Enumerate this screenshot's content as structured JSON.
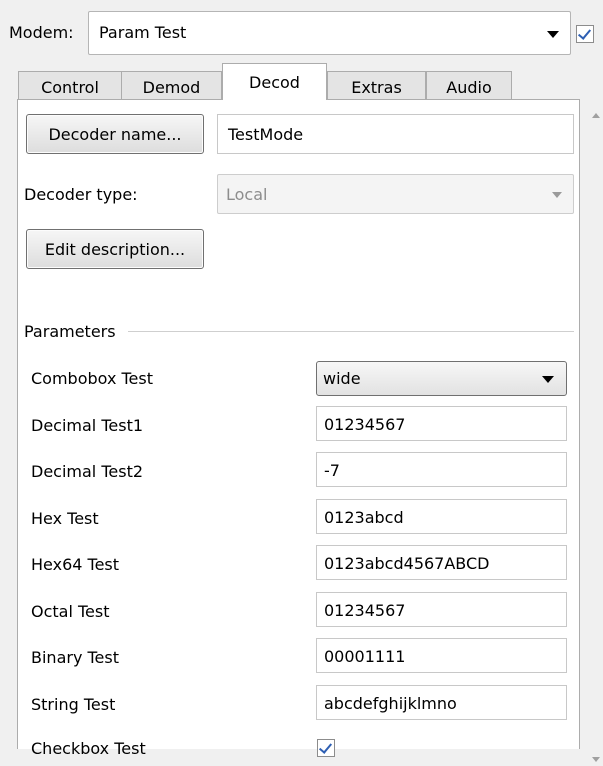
{
  "modem": {
    "label": "Modem:",
    "value": "Param Test",
    "enabled": true
  },
  "tabs": [
    {
      "label": "Control"
    },
    {
      "label": "Demod"
    },
    {
      "label": "Decod",
      "active": true
    },
    {
      "label": "Extras"
    },
    {
      "label": "Audio"
    }
  ],
  "decoder": {
    "name_button": "Decoder name...",
    "name_value": "TestMode",
    "type_label": "Decoder type:",
    "type_value": "Local",
    "edit_button": "Edit description..."
  },
  "parameters": {
    "title": "Parameters",
    "combobox": {
      "label": "Combobox Test",
      "value": "wide"
    },
    "decimal1": {
      "label": "Decimal Test1",
      "value": "01234567"
    },
    "decimal2": {
      "label": "Decimal Test2",
      "value": "-7"
    },
    "hex": {
      "label": "Hex Test",
      "value": "0123abcd"
    },
    "hex64": {
      "label": "Hex64 Test",
      "value": "0123abcd4567ABCD"
    },
    "octal": {
      "label": "Octal Test",
      "value": "01234567"
    },
    "binary": {
      "label": "Binary Test",
      "value": "00001111"
    },
    "string": {
      "label": "String Test",
      "value": "abcdefghijklmno"
    },
    "checkbox": {
      "label": "Checkbox Test",
      "checked": true
    }
  }
}
